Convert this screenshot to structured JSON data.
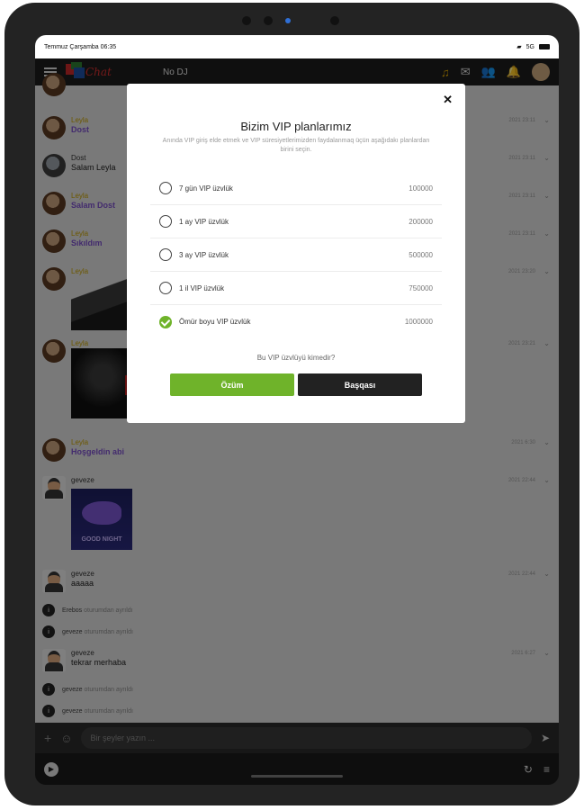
{
  "status": {
    "datetime": "Temmuz Çarşamba 06:35",
    "network": "5G"
  },
  "appbar": {
    "logo_text": "Chat",
    "dj_label": "No DJ"
  },
  "messages": [
    {
      "user": "Leyla",
      "text": "Dost",
      "time": "2021 23:11"
    },
    {
      "user": "Dost",
      "text": "Salam Leyla",
      "time": "2021 23:11"
    },
    {
      "user": "Leyla",
      "text": "Salam Dost",
      "time": "2021 23:11"
    },
    {
      "user": "Leyla",
      "text": "Sıkıldım",
      "time": "2021 23:11"
    },
    {
      "user": "Leyla",
      "text": "",
      "time": "2021 23:20"
    },
    {
      "user": "Leyla",
      "text": "",
      "time": "2021 23:21"
    },
    {
      "user": "Leyla",
      "text": "Hoşgeldin abi",
      "time": "2021 6:30"
    },
    {
      "user": "geveze",
      "text": "",
      "time": "2021 22:44",
      "image_text": "GOOD NIGHT"
    },
    {
      "user": "geveze",
      "text": "aaaaa",
      "time": "2021 22:44"
    },
    {
      "user": "geveze",
      "text": "tekrar merhaba",
      "time": "2021 6:27"
    }
  ],
  "system": [
    {
      "who": "Erebos",
      "what": "oturumdan ayrıldı"
    },
    {
      "who": "geveze",
      "what": "oturumdan ayrıldı"
    },
    {
      "who": "geveze",
      "what": "oturumdan ayrıldı"
    },
    {
      "who": "geveze",
      "what": "oturumdan ayrıldı"
    }
  ],
  "composer": {
    "placeholder": "Bir şeyler yazın ..."
  },
  "modal": {
    "title": "Bizim VIP planlarımız",
    "description": "Anında VIP giriş elde etmek ve VIP süresiyetlerimizden faydalanmaq üçün aşağıdakı planlardan birini seçin.",
    "plans": [
      {
        "name": "7 gün VIP üzvlük",
        "price": "100000",
        "checked": false
      },
      {
        "name": "1 ay VIP üzvlük",
        "price": "200000",
        "checked": false
      },
      {
        "name": "3 ay VIP üzvlük",
        "price": "500000",
        "checked": false
      },
      {
        "name": "1 il VIP üzvlük",
        "price": "750000",
        "checked": false
      },
      {
        "name": "Ömür boyu VIP üzvlük",
        "price": "1000000",
        "checked": true
      }
    ],
    "question": "Bu VIP üzvlüyü kimedir?",
    "btn_self": "Özüm",
    "btn_other": "Başqası"
  }
}
